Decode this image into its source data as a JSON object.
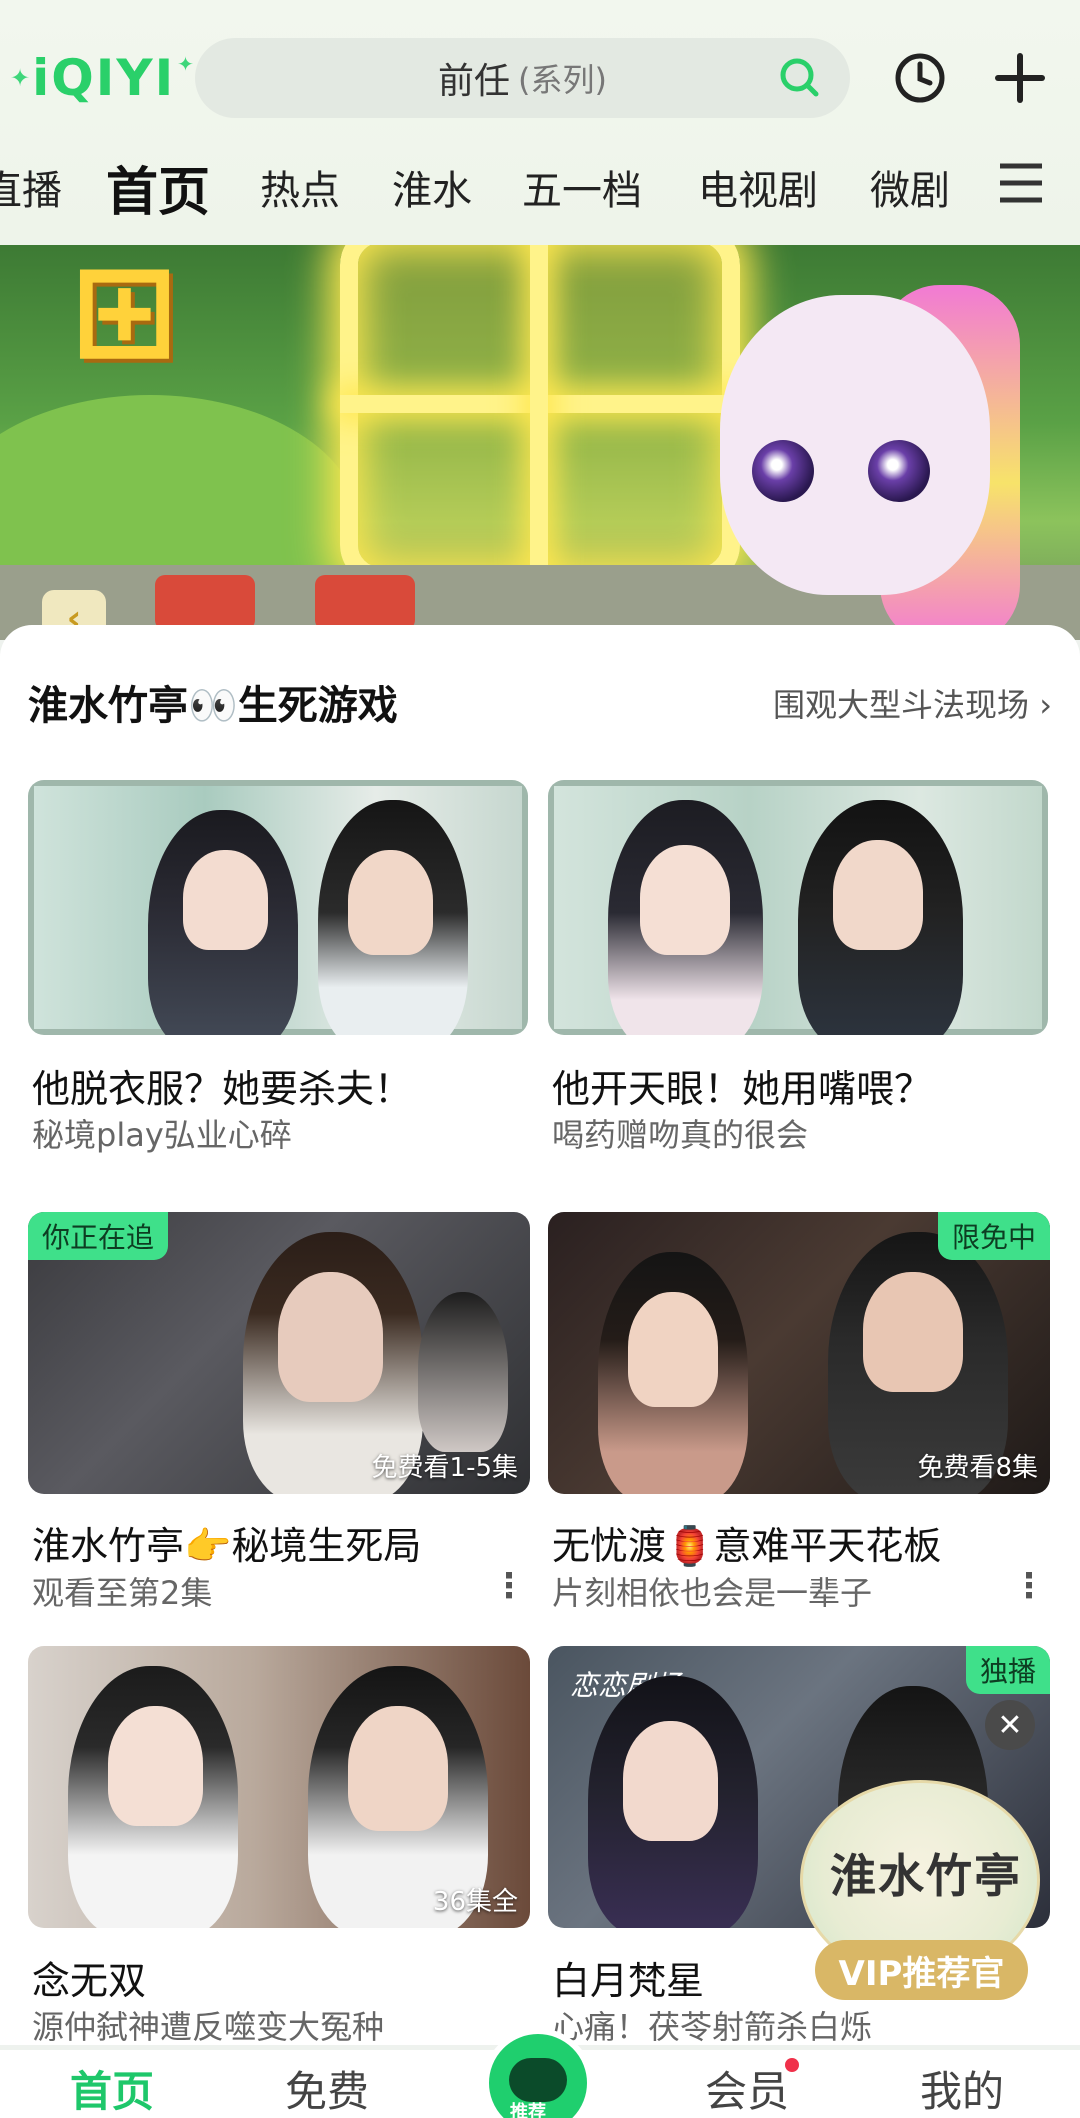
{
  "header": {
    "logo_text": "iQIYI",
    "search_keyword": "前任",
    "search_tag": "(系列)"
  },
  "tabs": [
    "直播",
    "首页",
    "热点",
    "淮水",
    "五一档",
    "电视剧",
    "微剧"
  ],
  "active_tab": "首页",
  "section": {
    "title": "淮水竹亭👀生死游戏",
    "link": "围观大型斗法现场 ›"
  },
  "featured": [
    {
      "title": "他脱衣服？她要杀夫！",
      "subtitle": "秘境play弘业心碎"
    },
    {
      "title": "他开天眼！她用嘴喂？",
      "subtitle": "喝药赠吻真的很会"
    }
  ],
  "grid": [
    {
      "badge": "你正在追",
      "episode": "免费看1-5集",
      "title": "淮水竹亭👉秘境生死局",
      "subtitle": "观看至第2集"
    },
    {
      "badge": "限免中",
      "episode": "免费看8集",
      "title": "无忧渡🏮意难平天花板",
      "subtitle": "片刻相依也会是一辈子"
    },
    {
      "badge": "",
      "episode": "36集全",
      "title": "念无双",
      "subtitle": "源仲弑神遭反噬变大冤种"
    },
    {
      "badge": "独播",
      "episode": "",
      "title": "白月梵星",
      "subtitle": "心痛！茯苓射箭杀白烁"
    }
  ],
  "promo": {
    "text": "淮水竹亭",
    "button": "VIP推荐官",
    "logo_text": "恋恋剧场"
  },
  "bottom_nav": {
    "home": "首页",
    "free": "免费",
    "center": "推荐",
    "vip": "会员",
    "me": "我的"
  },
  "colors": {
    "accent": "#1ec76a",
    "badge": "#3fe08a",
    "promo": "#d9b766"
  }
}
